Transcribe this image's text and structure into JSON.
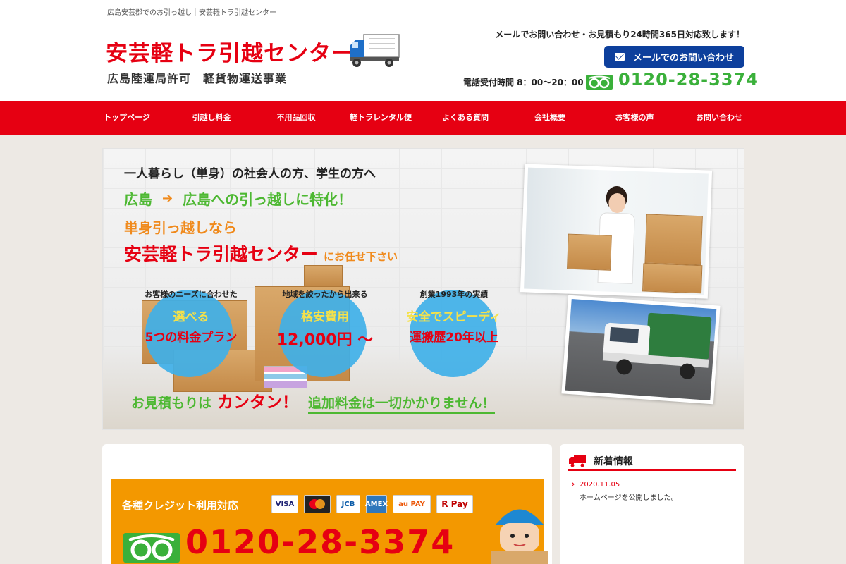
{
  "header": {
    "tagline": "広島安芸郡でのお引っ越し｜安芸軽トラ引越センター",
    "logo": "安芸軽トラ引越センター",
    "license": "広島陸運局許可　軽貨物運送事業",
    "mail_note": "メールでお問い合わせ・お見積もり24時間365日対応致します！",
    "mail_button": "メールでのお問い合わせ",
    "hours": "電話受付時間 8：00〜20：00",
    "phone": "0120-28-3374"
  },
  "nav": {
    "items": [
      {
        "label": "トップページ"
      },
      {
        "label": "引越し料金"
      },
      {
        "label": "不用品回収"
      },
      {
        "label": "軽トラレンタル便"
      },
      {
        "label": "よくある質問"
      },
      {
        "label": "会社概要"
      },
      {
        "label": "お客様の声"
      },
      {
        "label": "お問い合わせ"
      }
    ]
  },
  "hero": {
    "line1": "一人暮らし（単身）の社会人の方、学生の方へ",
    "line2_from": "広島",
    "line2_arrow": "➔",
    "line2_to": "広島への引っ越しに特化！",
    "line3": "単身引っ越しなら",
    "line4_main": "安芸軽トラ引越センター",
    "line4_sub": "にお任せ下さい",
    "features": [
      {
        "caption": "お客様のニーズに合わせた",
        "l1": "選べる",
        "l2": "5つの料金プラン"
      },
      {
        "caption": "地域を絞ったから出来る",
        "l1": "格安費用",
        "l2": "12,000円 〜"
      },
      {
        "caption": "創業1993年の実績",
        "l1": "安全でスピーディ",
        "l2": "運搬歴20年以上"
      }
    ],
    "bottom_a": "お見積もりは",
    "bottom_b": "カンタン！",
    "bottom_c": "追加料金は一切かかりません！"
  },
  "main": {
    "credit_title": "各種クレジット利用対応",
    "cards": [
      "VISA",
      "MasterCard",
      "JCB",
      "AMEX",
      "au PAY",
      "R Pay"
    ],
    "phone": "0120-28-3374"
  },
  "sidebar": {
    "title": "新着情報",
    "news": [
      {
        "date": "2020.11.05",
        "text": "ホームページを公開しました。"
      }
    ]
  },
  "colors": {
    "brand_red": "#e60012",
    "accent_green": "#4db832",
    "accent_orange": "#f39800",
    "mail_blue": "#0d3f9c"
  }
}
